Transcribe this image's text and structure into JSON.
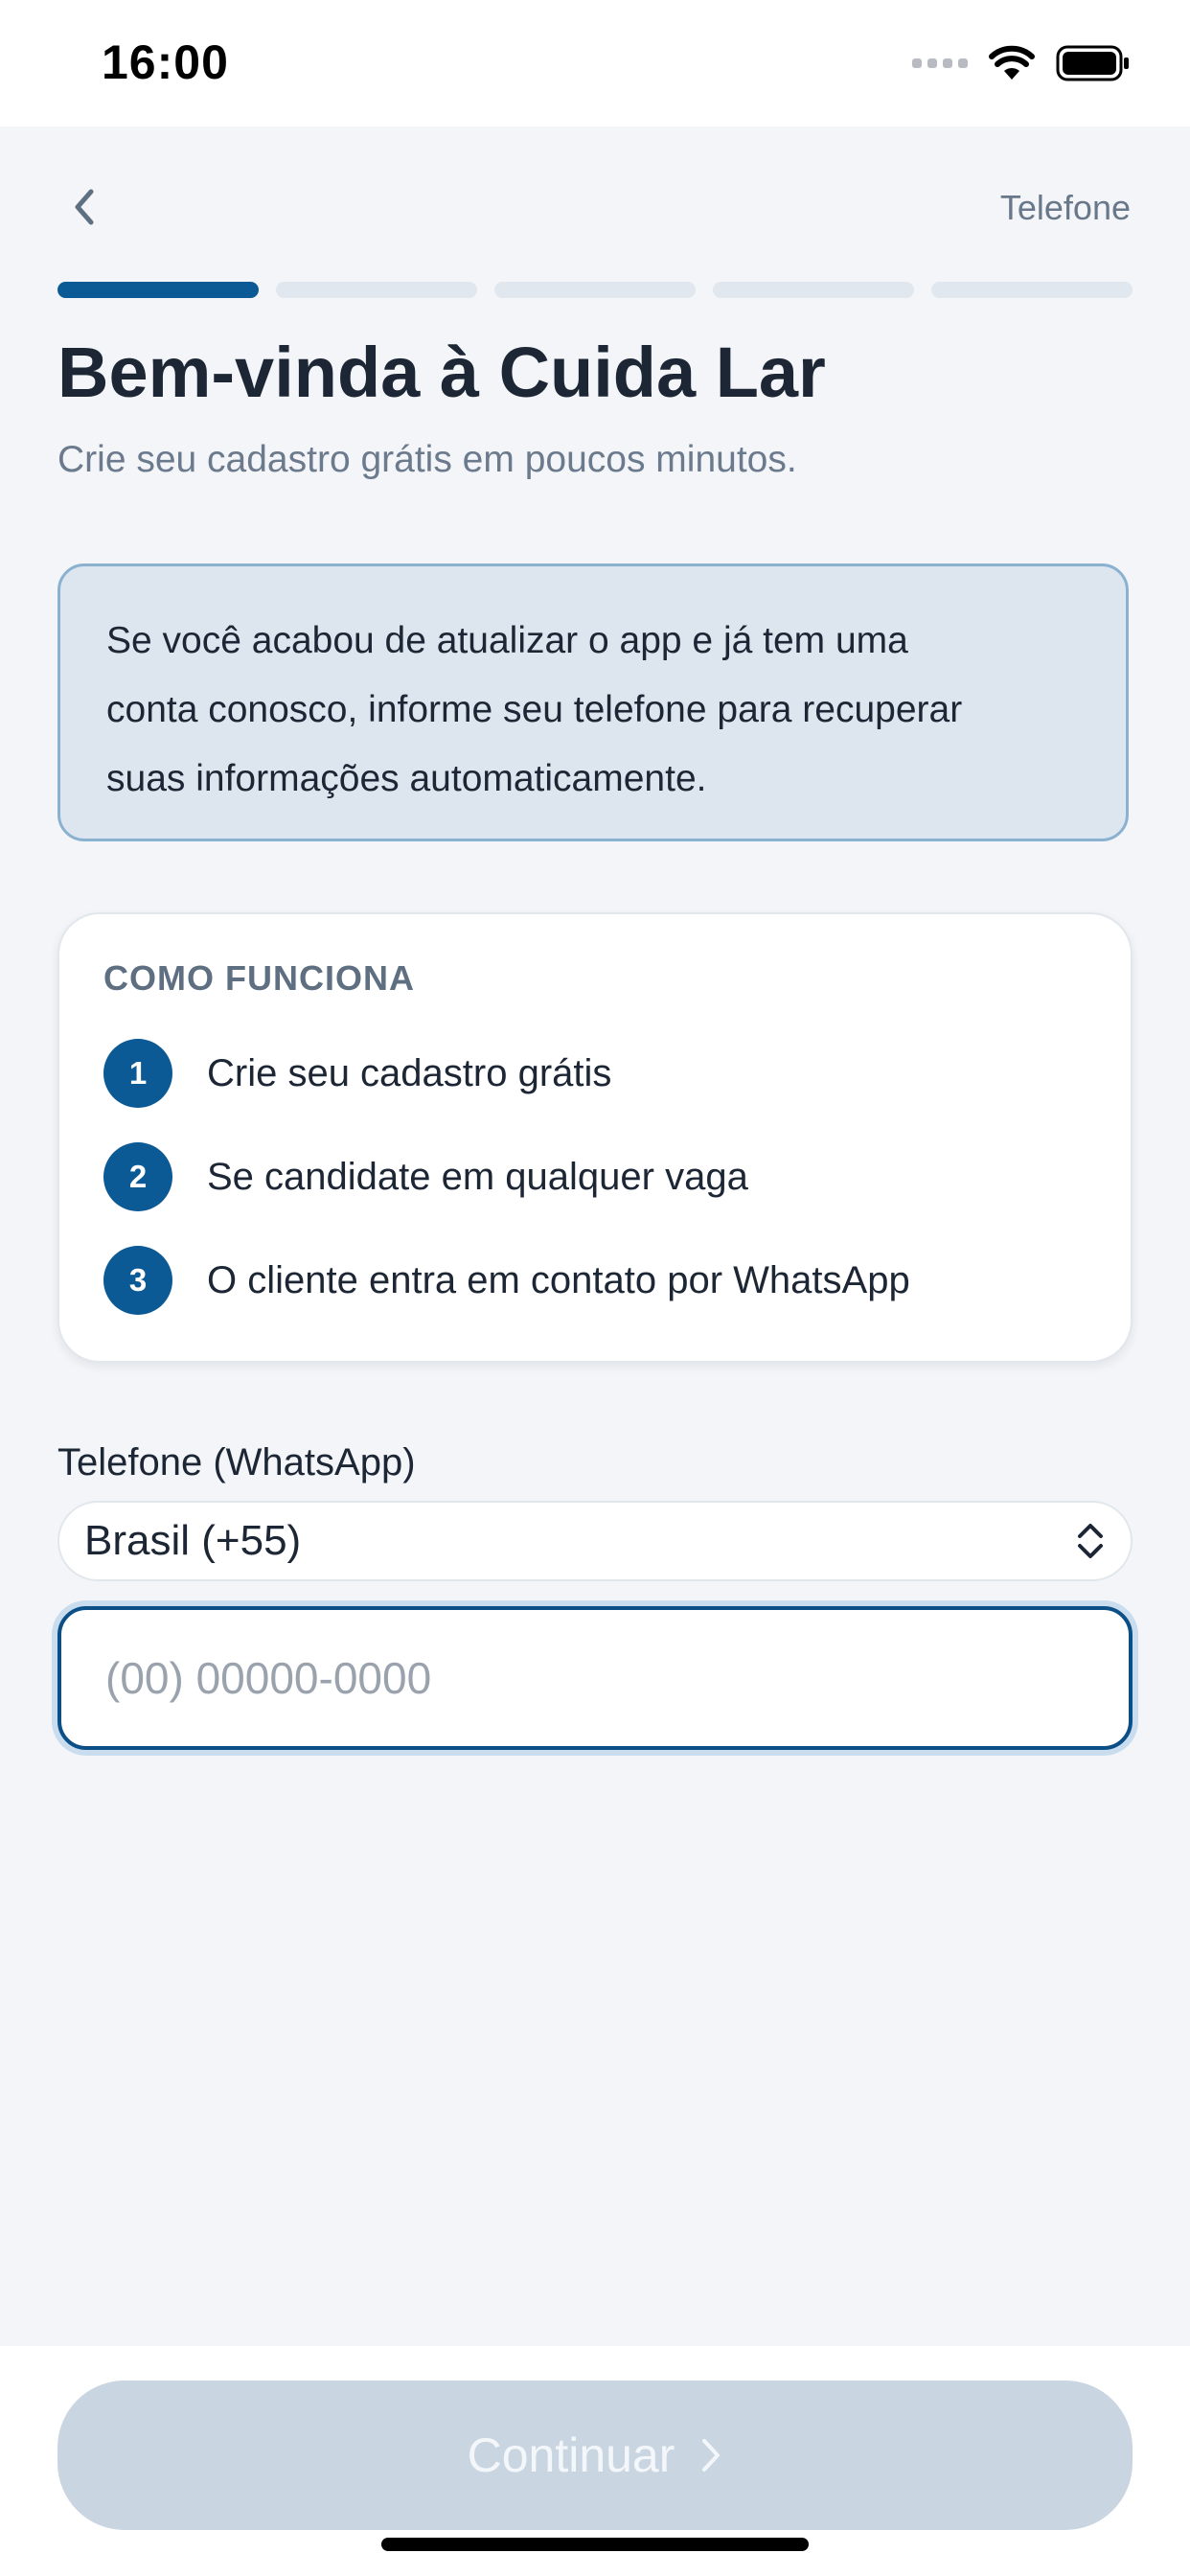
{
  "status_bar": {
    "time": "16:00",
    "icons": [
      "cellular-signal-icon",
      "wifi-icon",
      "battery-icon"
    ]
  },
  "header": {
    "back_icon": "chevron-left-icon",
    "step_label": "Telefone"
  },
  "progress": {
    "current_step": 1,
    "total_steps": 5,
    "active_color": "#0b5a96",
    "inactive_color": "#e1e7ee"
  },
  "welcome": {
    "title": "Bem-vinda à Cuida Lar",
    "subtitle": "Crie seu cadastro grátis em poucos minutos."
  },
  "info_box": {
    "lines": [
      "Se você acabou de atualizar o app e já tem uma",
      "conta conosco, informe seu telefone para recuperar",
      "suas informações automaticamente."
    ]
  },
  "how_it_works": {
    "title": "COMO FUNCIONA",
    "steps": [
      {
        "number": "1",
        "text": "Crie seu cadastro grátis"
      },
      {
        "number": "2",
        "text": "Se candidate em qualquer vaga"
      },
      {
        "number": "3",
        "text": "O cliente entra em contato por WhatsApp"
      }
    ]
  },
  "phone_form": {
    "label": "Telefone (WhatsApp)",
    "country_value": "Brasil (+55)",
    "country_icon": "chevron-up-down-icon",
    "phone_value": "",
    "phone_placeholder": "(00) 00000-0000"
  },
  "footer": {
    "continue_label": "Continuar",
    "continue_icon": "chevron-right-icon",
    "continue_enabled": false
  },
  "colors": {
    "brand": "#0b5a96",
    "background": "#f3f5f8",
    "info_bg": "#dde6ef",
    "info_border": "#8ab1d0",
    "disabled_button": "#c9d6e2"
  }
}
